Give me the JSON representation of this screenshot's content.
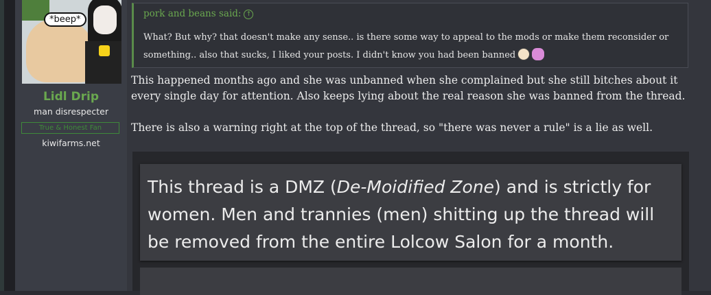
{
  "user": {
    "avatar_caption": "*beep*",
    "username": "Lidl Drip",
    "title": "man disrespecter",
    "banner": "True & Honest Fan",
    "site": "kiwifarms.net"
  },
  "quote": {
    "author": "pork and beans said:",
    "arrow": "↑",
    "text": "What? But why? that doesn't make any sense.. is there some way to appeal to the mods or make them reconsider or something.. also that sucks, I liked your posts. I didn't know you had been banned"
  },
  "reply": {
    "p1": "This happened months ago and she was unbanned when she complained but she still bitches about it every single day for attention. Also keeps lying about the real reason she was banned from the thread.",
    "p2": "There is also a warning right at the top of the thread, so \"there was never a rule\" is a lie as well."
  },
  "screenshot": {
    "text_pre": "This thread is a DMZ (",
    "text_em": "De-Moidified Zone",
    "text_post": ") and is strictly for women. Men and trannies (men) shitting up the thread will be removed from the entire Lolcow Salon for a month."
  }
}
